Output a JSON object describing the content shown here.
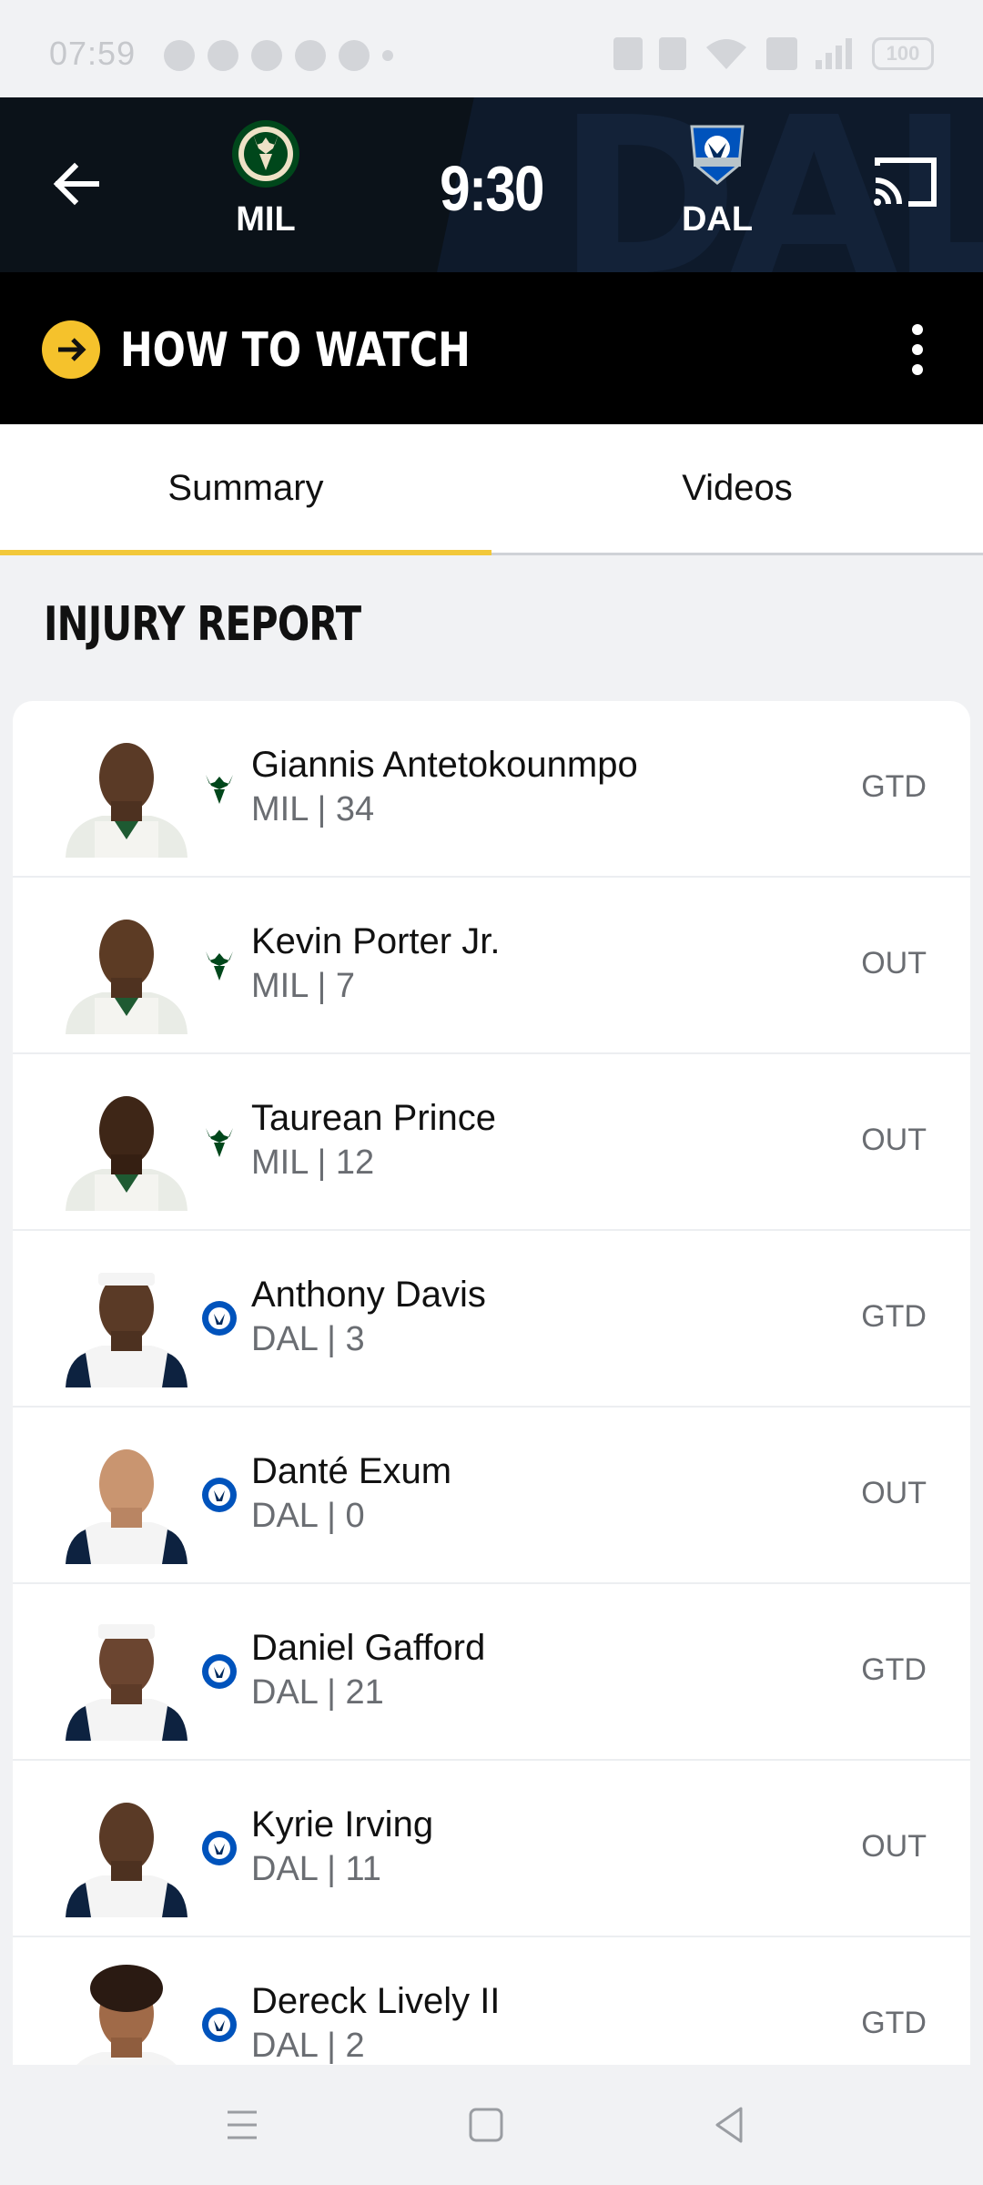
{
  "status_bar": {
    "time": "07:59",
    "battery": "100",
    "notification_icons": [
      "facebook-icon",
      "facebook-icon",
      "facebook-icon",
      "messenger-icon",
      "line-icon"
    ],
    "system_icons": [
      "nfc-icon",
      "vibrate-icon",
      "wifi-icon",
      "volte-icon",
      "signal-icon",
      "battery-icon"
    ]
  },
  "header": {
    "home_team": "MIL",
    "away_team": "DAL",
    "game_time": "9:30",
    "home_color": "#00471b",
    "away_color": "#0053bc",
    "background_text": "DAL"
  },
  "watch_bar": {
    "label": "HOW TO WATCH",
    "accent": "#f5c22c"
  },
  "tabs": [
    {
      "label": "Summary",
      "active": true
    },
    {
      "label": "Videos",
      "active": false
    }
  ],
  "injury_report": {
    "title": "INJURY REPORT",
    "players": [
      {
        "name": "Giannis Antetokounmpo",
        "meta": "MIL | 34",
        "status": "GTD",
        "team": "MIL"
      },
      {
        "name": "Kevin Porter Jr.",
        "meta": "MIL | 7",
        "status": "OUT",
        "team": "MIL"
      },
      {
        "name": "Taurean Prince",
        "meta": "MIL | 12",
        "status": "OUT",
        "team": "MIL"
      },
      {
        "name": "Anthony Davis",
        "meta": "DAL | 3",
        "status": "GTD",
        "team": "DAL"
      },
      {
        "name": "Danté Exum",
        "meta": "DAL | 0",
        "status": "OUT",
        "team": "DAL"
      },
      {
        "name": "Daniel Gafford",
        "meta": "DAL | 21",
        "status": "GTD",
        "team": "DAL"
      },
      {
        "name": "Kyrie Irving",
        "meta": "DAL | 11",
        "status": "OUT",
        "team": "DAL"
      },
      {
        "name": "Dereck Lively II",
        "meta": "DAL | 2",
        "status": "GTD",
        "team": "DAL"
      }
    ]
  }
}
